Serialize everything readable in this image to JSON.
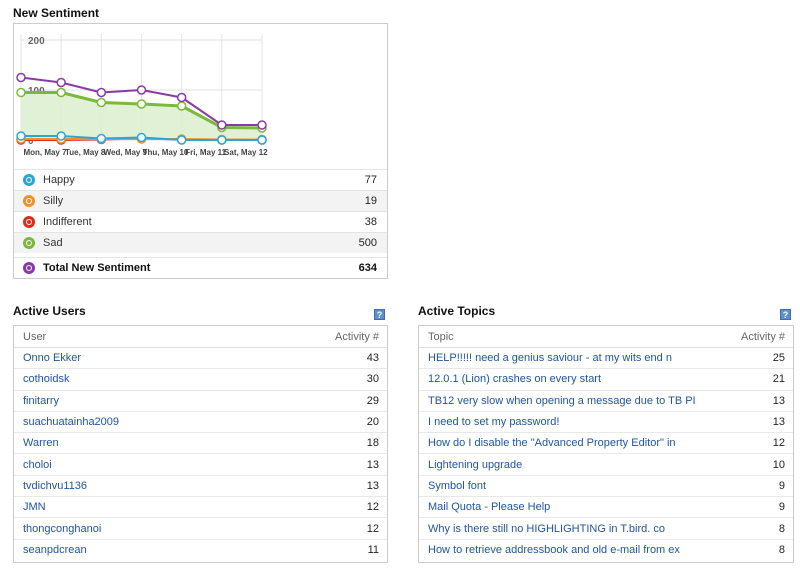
{
  "sentiment": {
    "title": "New Sentiment",
    "legend": [
      {
        "label": "Happy",
        "value": "77",
        "color": "#2aa6d6"
      },
      {
        "label": "Silly",
        "value": "19",
        "color": "#f0902a"
      },
      {
        "label": "Indifferent",
        "value": "38",
        "color": "#e02a1a"
      },
      {
        "label": "Sad",
        "value": "500",
        "color": "#7ab93a"
      }
    ],
    "total": {
      "label": "Total New Sentiment",
      "value": "634",
      "color": "#8a3aa6"
    }
  },
  "chart_data": {
    "type": "line",
    "categories": [
      "Mon, May 7",
      "Tue, May 8",
      "Wed, May 9",
      "Thu, May 10",
      "Fri, May 11",
      "Sat, May 12"
    ],
    "x_ticks": [
      "Mon, May 7",
      "Tue, May 8",
      "Wed, May 9",
      "Thu, May 10",
      "Fri, May 11",
      "Sat, May 12"
    ],
    "x": [
      0,
      1,
      2,
      3,
      4,
      5,
      6
    ],
    "y_ticks": [
      "200",
      "100",
      "0"
    ],
    "ylim": [
      0,
      200
    ],
    "series": [
      {
        "name": "Total New Sentiment",
        "color": "#8a3aa6",
        "values": [
          125,
          115,
          95,
          100,
          85,
          30,
          30
        ]
      },
      {
        "name": "Sad",
        "color": "#7ab93a",
        "values": [
          95,
          95,
          75,
          72,
          68,
          25,
          24
        ],
        "fill": true
      },
      {
        "name": "Happy",
        "color": "#2aa6d6",
        "values": [
          8,
          8,
          3,
          5,
          0,
          0,
          0
        ]
      },
      {
        "name": "Silly",
        "color": "#f0902a",
        "values": [
          2,
          2,
          2,
          2,
          2,
          1,
          1
        ]
      },
      {
        "name": "Indifferent",
        "color": "#e02a1a",
        "values": [
          0,
          0,
          1,
          3,
          1,
          0,
          0
        ]
      }
    ]
  },
  "users": {
    "title": "Active Users",
    "help": "?",
    "col1": "User",
    "col2": "Activity #",
    "rows": [
      {
        "name": "Onno Ekker",
        "count": "43"
      },
      {
        "name": "cothoidsk",
        "count": "30"
      },
      {
        "name": "finitarry",
        "count": "29"
      },
      {
        "name": "suachuatainha2009",
        "count": "20"
      },
      {
        "name": "Warren",
        "count": "18"
      },
      {
        "name": "choloi",
        "count": "13"
      },
      {
        "name": "tvdichvu1136",
        "count": "13"
      },
      {
        "name": "JMN",
        "count": "12"
      },
      {
        "name": "thongconghanoi",
        "count": "12"
      },
      {
        "name": "seanpdcrean",
        "count": "11"
      }
    ]
  },
  "topics": {
    "title": "Active Topics",
    "help": "?",
    "col1": "Topic",
    "col2": "Activity #",
    "rows": [
      {
        "name": "HELP!!!!! need a genius saviour - at my wits end n",
        "count": "25"
      },
      {
        "name": "12.0.1 (Lion) crashes on every start",
        "count": "21"
      },
      {
        "name": "TB12 very slow when opening a message due to TB PI",
        "count": "13"
      },
      {
        "name": "I need to set my password!",
        "count": "13"
      },
      {
        "name": "How do I disable the \"Advanced Property Editor\" in",
        "count": "12"
      },
      {
        "name": "Lightening upgrade",
        "count": "10"
      },
      {
        "name": "Symbol font",
        "count": "9"
      },
      {
        "name": "Mail Quota - Please Help",
        "count": "9"
      },
      {
        "name": "Why is there still no HIGHLIGHTING in T.bird. co",
        "count": "8"
      },
      {
        "name": "How to retrieve addressbook and old e-mail from ex",
        "count": "8"
      }
    ]
  }
}
